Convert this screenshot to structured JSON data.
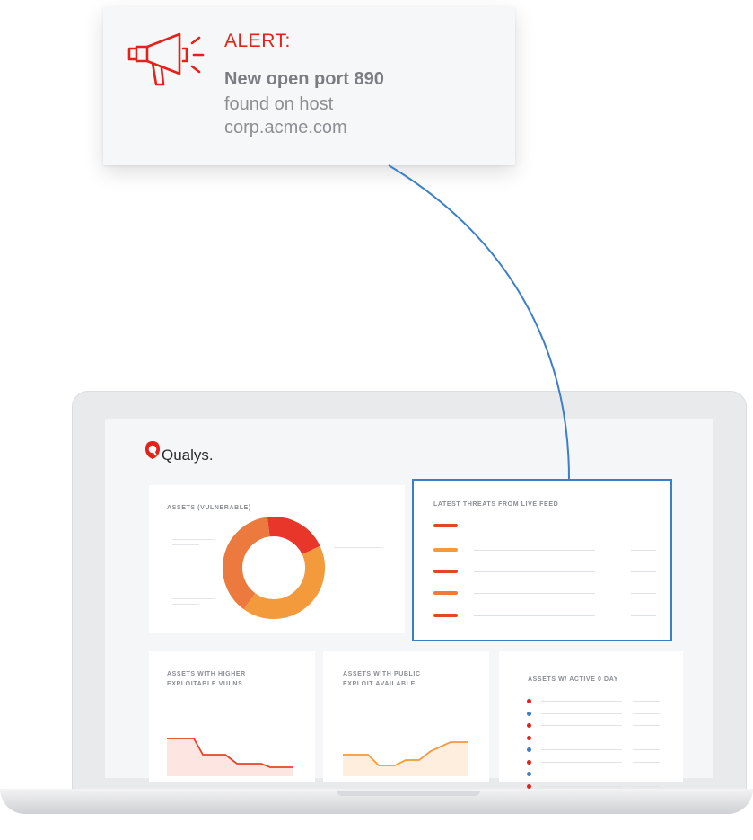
{
  "alert": {
    "title": "ALERT:",
    "line1": "New open port 890",
    "line2": "found on host",
    "line3": "corp.acme.com",
    "icon": "megaphone-icon",
    "title_color": "#e2231a"
  },
  "dashboard": {
    "logo_text": "Qualys.",
    "logo_icon": "qualys-shield-icon",
    "panels": {
      "assets": {
        "title": "ASSETS (VULNERABLE)"
      },
      "threats": {
        "title": "LATEST THREATS FROM LIVE FEED",
        "bar_colors": [
          "#e2452a",
          "#f39a3c",
          "#e2452a",
          "#ee7b3d",
          "#e2452a"
        ]
      },
      "higher_vuln": {
        "title_line1": "ASSETS WITH HIGHER",
        "title_line2": "EXPLOITABLE VULNS"
      },
      "public_exploit": {
        "title_line1": "ASSETS WITH PUBLIC",
        "title_line2": "EXPLOIT AVAILABLE"
      },
      "active_ear": {
        "title": "ASSETS W/ ACTIVE 0 DAY"
      }
    }
  },
  "chart_data": [
    {
      "type": "pie",
      "title": "ASSETS (VULNERABLE)",
      "slices": [
        {
          "value": 20,
          "color": "#e8362a"
        },
        {
          "value": 42,
          "color": "#f39a3c"
        },
        {
          "value": 38,
          "color": "#ec7a3e"
        }
      ]
    }
  ],
  "colors": {
    "accent": "#e2231a",
    "highlight_box": "#3c7fc9",
    "connector": "#3c7fc9"
  }
}
